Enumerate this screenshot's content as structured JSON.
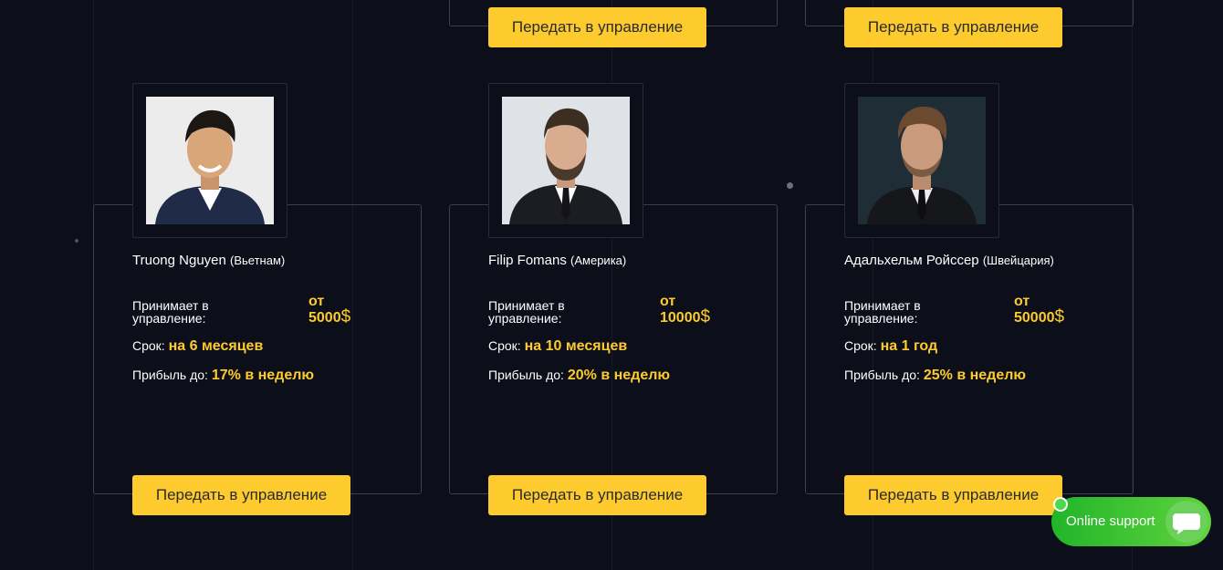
{
  "top_buttons": [
    "Передать в управление",
    "Передать в управление"
  ],
  "managers": [
    {
      "name": "Truong Nguyen",
      "country": "(Вьетнам)",
      "accepts_label_line1": "Принимает в",
      "accepts_label_line2": "управление:",
      "from_label": "от",
      "amount": "5000",
      "currency": "$",
      "term_label": "Срок:",
      "term_value": "на 6 месяцев",
      "profit_label": "Прибыль до:",
      "profit_value": "17% в неделю",
      "button_label": "Передать в управление",
      "photo_bg": "#ececec",
      "suit_color": "#1f2b47"
    },
    {
      "name": "Filip Fomans",
      "country": "(Америка)",
      "accepts_label_line1": "Принимает в",
      "accepts_label_line2": "управление:",
      "from_label": "от",
      "amount": "10000",
      "currency": "$",
      "term_label": "Срок:",
      "term_value": "на 10 месяцев",
      "profit_label": "Прибыль до:",
      "profit_value": "20% в неделю",
      "button_label": "Передать в управление",
      "photo_bg": "#dfe2e7",
      "suit_color": "#1c1d22"
    },
    {
      "name": "Адальхельм Ройссер",
      "country": "(Швейцария)",
      "accepts_label_line1": "Принимает в",
      "accepts_label_line2": "управление:",
      "from_label": "от",
      "amount": "50000",
      "currency": "$",
      "term_label": "Срок:",
      "term_value": "на 1 год",
      "profit_label": "Прибыль до:",
      "profit_value": "25% в неделю",
      "button_label": "Передать в управление",
      "photo_bg": "#1f2d36",
      "suit_color": "#15171b"
    }
  ],
  "support": {
    "label": "Online support"
  },
  "colors": {
    "background": "#0c0e1a",
    "accent": "#fdcb2e",
    "card_border": "#3a3f4e",
    "support_green": "#3ec434"
  }
}
